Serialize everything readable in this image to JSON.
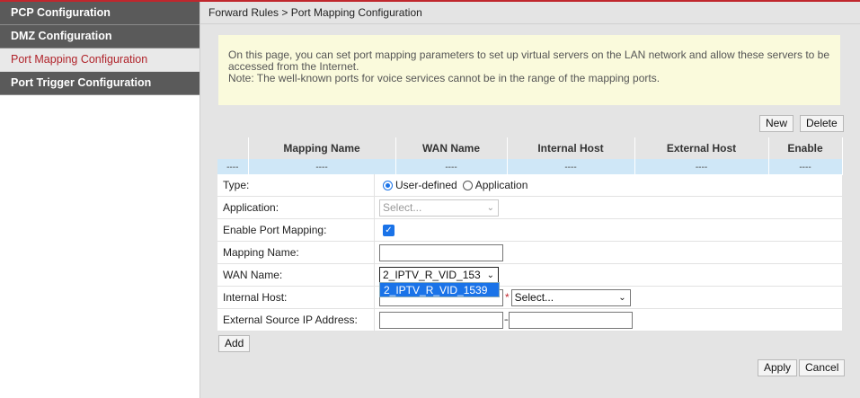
{
  "sidebar": {
    "items": [
      {
        "label": "PCP Configuration"
      },
      {
        "label": "DMZ Configuration"
      },
      {
        "label": "Port Mapping Configuration"
      },
      {
        "label": "Port Trigger Configuration"
      }
    ]
  },
  "breadcrumb": "Forward Rules > Port Mapping Configuration",
  "note": {
    "line1": "On this page, you can set port mapping parameters to set up virtual servers on the LAN network and allow these servers to be accessed from the Internet.",
    "line2": "Note: The well-known ports for voice services cannot be in the range of the mapping ports."
  },
  "toolbar": {
    "new_label": "New",
    "delete_label": "Delete"
  },
  "table": {
    "headers": [
      "",
      "Mapping Name",
      "WAN Name",
      "Internal Host",
      "External Host",
      "Enable"
    ],
    "row": [
      "----",
      "----",
      "----",
      "----",
      "----",
      "----"
    ]
  },
  "form": {
    "type_label": "Type:",
    "type_options": [
      "User-defined",
      "Application"
    ],
    "type_selected": "User-defined",
    "application_label": "Application:",
    "application_placeholder": "Select...",
    "enable_label": "Enable Port Mapping:",
    "enable_checked": true,
    "mapping_name_label": "Mapping Name:",
    "mapping_name_value": "",
    "wan_name_label": "WAN Name:",
    "wan_name_value": "2_IPTV_R_VID_153",
    "wan_name_option": "2_IPTV_R_VID_1539",
    "internal_host_label": "Internal Host:",
    "internal_host_select": "Select...",
    "ext_source_label": "External Source IP Address:",
    "ext_source_separator": "--"
  },
  "actions": {
    "add_label": "Add",
    "apply_label": "Apply",
    "cancel_label": "Cancel"
  },
  "colors": {
    "accent": "#c0272d",
    "selection": "#1a73e8",
    "note_bg": "#fafadc",
    "table_row": "#cfe7f7"
  }
}
